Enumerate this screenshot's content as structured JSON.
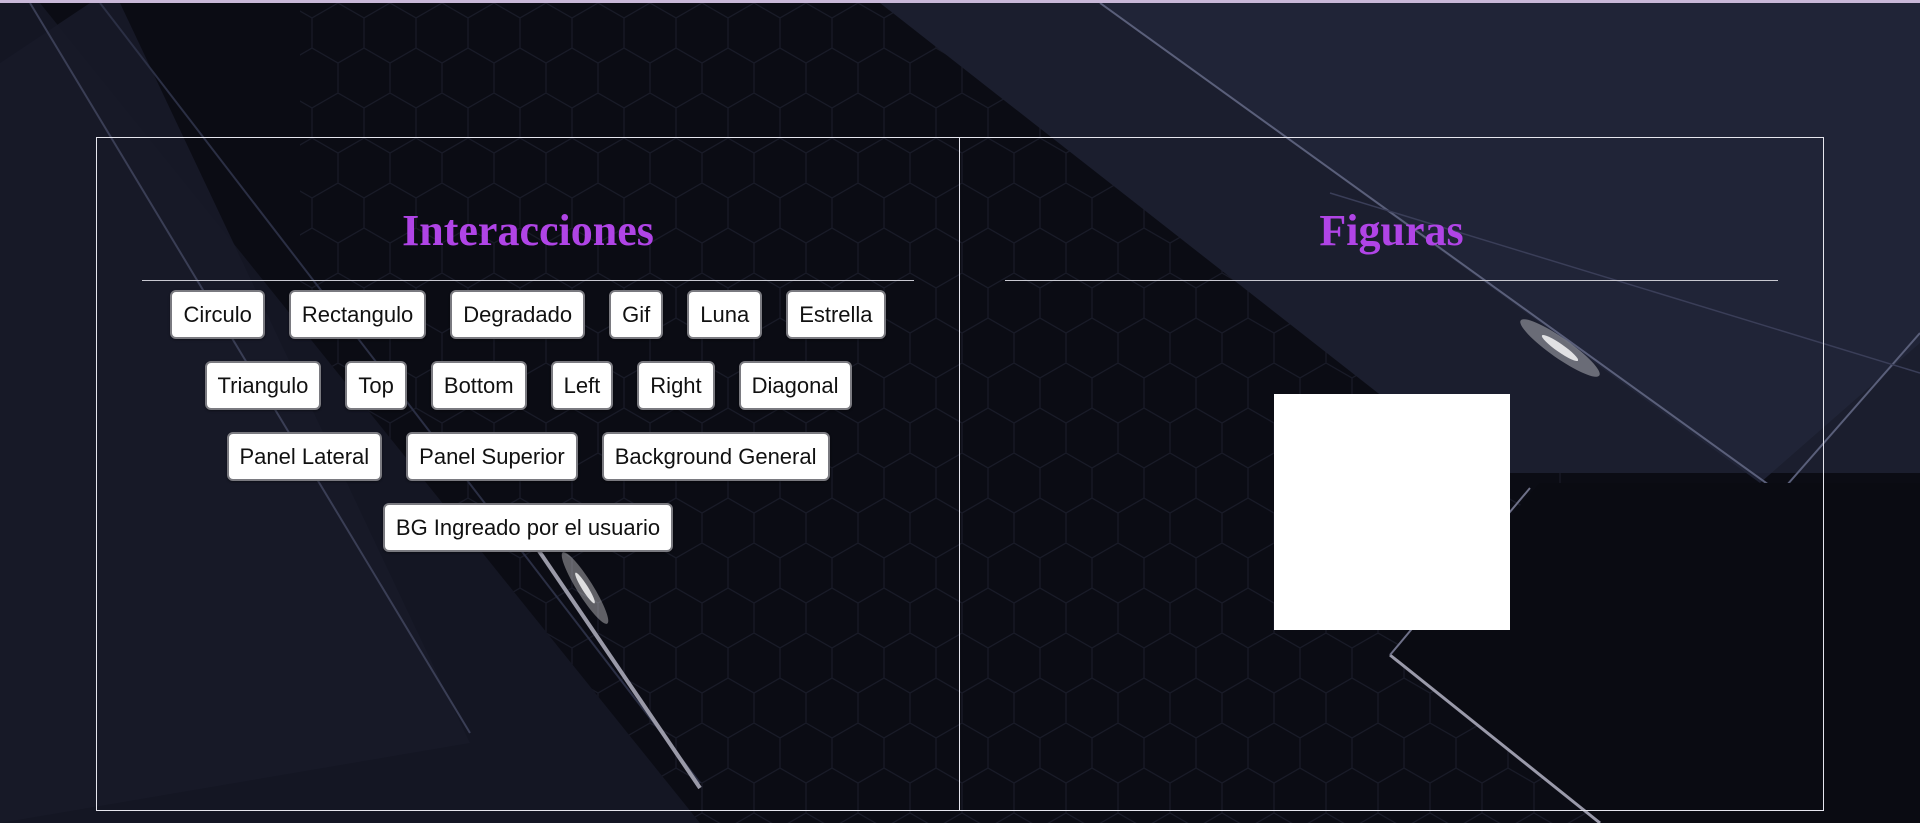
{
  "left_panel": {
    "title": "Interacciones",
    "buttons": [
      "Circulo",
      "Rectangulo",
      "Degradado",
      "Gif",
      "Luna",
      "Estrella",
      "Triangulo",
      "Top",
      "Bottom",
      "Left",
      "Right",
      "Diagonal",
      "Panel Lateral",
      "Panel Superior",
      "Background General",
      "BG Ingreado por el usuario"
    ]
  },
  "right_panel": {
    "title": "Figuras",
    "figure": {
      "shape": "rectangle",
      "color": "#ffffff"
    }
  },
  "colors": {
    "title": "#b044e6",
    "background": "#0b0c14",
    "border": "#e6e6ee"
  }
}
